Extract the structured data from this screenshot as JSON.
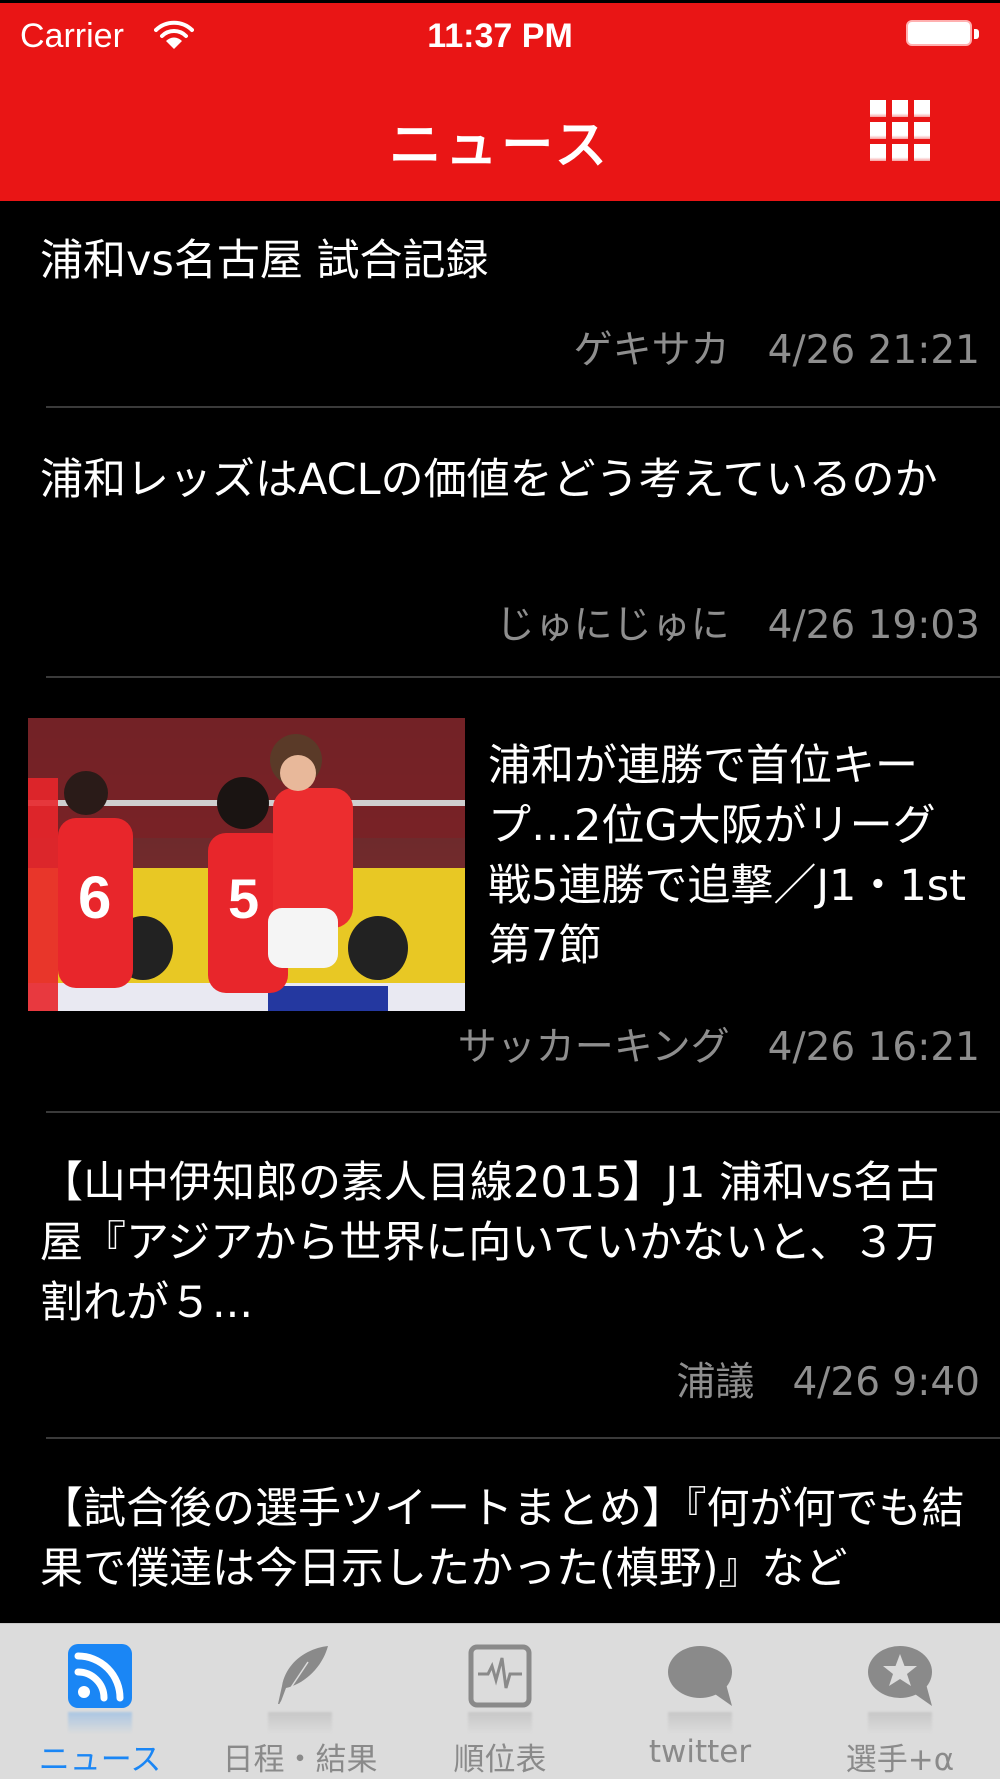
{
  "status_bar": {
    "carrier": "Carrier",
    "time": "11:37 PM",
    "icons": [
      "wifi-icon",
      "battery-icon"
    ]
  },
  "nav": {
    "title": "ニュース",
    "menu_icon": "grid-menu-icon"
  },
  "colors": {
    "header": "#e91515",
    "background": "#000000",
    "tab_active": "#1a86f5",
    "tab_inactive": "#8a8a8a",
    "meta_text": "#8e8e8e"
  },
  "news": [
    {
      "title": "浦和vs名古屋 試合記録",
      "source": "ゲキサカ",
      "date": "4/26 21:21",
      "has_image": false
    },
    {
      "title": "浦和レッズはACLの価値をどう考えているのか",
      "source": "じゅにじゅに",
      "date": "4/26 19:03",
      "has_image": false
    },
    {
      "title": "浦和が連勝で首位キープ…2位G大阪がリーグ戦5連勝で追撃／J1・1st第7節",
      "source": "サッカーキング",
      "date": "4/26 16:21",
      "has_image": true,
      "image_alt": "soccer players celebrating"
    },
    {
      "title": "【山中伊知郎の素人目線2015】J1 浦和vs名古屋『アジアから世界に向いていかないと、３万割れが５...",
      "source": "浦議",
      "date": "4/26 9:40",
      "has_image": false
    },
    {
      "title": "【試合後の選手ツイートまとめ】『何が何でも結果で僕達は今日示したかった(槙野)』など",
      "source": "",
      "date": "",
      "has_image": false
    }
  ],
  "tabs": [
    {
      "label": "ニュース",
      "icon": "rss-icon",
      "active": true
    },
    {
      "label": "日程・結果",
      "icon": "feather-icon",
      "active": false
    },
    {
      "label": "順位表",
      "icon": "pulse-chart-icon",
      "active": false
    },
    {
      "label": "twitter",
      "icon": "speech-bubble-icon",
      "active": false
    },
    {
      "label": "選手+α",
      "icon": "star-bubble-icon",
      "active": false
    }
  ]
}
